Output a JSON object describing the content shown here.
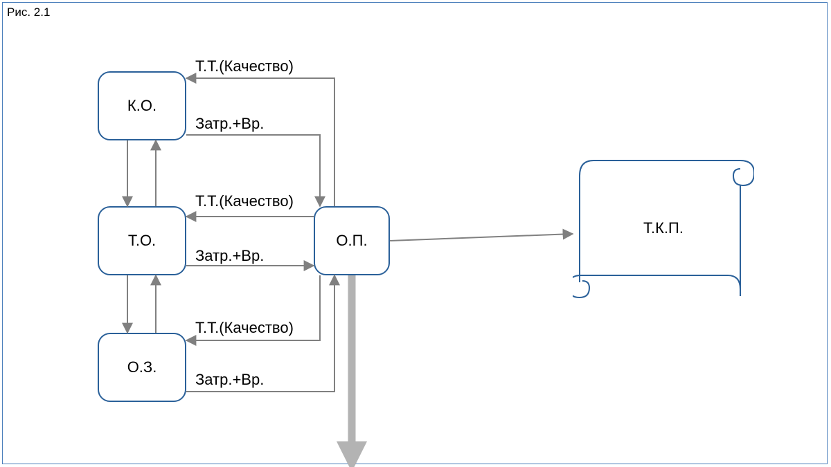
{
  "caption": "Рис. 2.1",
  "nodes": {
    "ko": {
      "label": "К.О."
    },
    "to": {
      "label": "Т.О."
    },
    "oz": {
      "label": "О.З."
    },
    "op": {
      "label": "О.П."
    },
    "tkp": {
      "label": "Т.К.П."
    }
  },
  "edgeLabels": {
    "tt": "Т.Т.(Качество)",
    "zatr": "Затр.+Вр."
  }
}
